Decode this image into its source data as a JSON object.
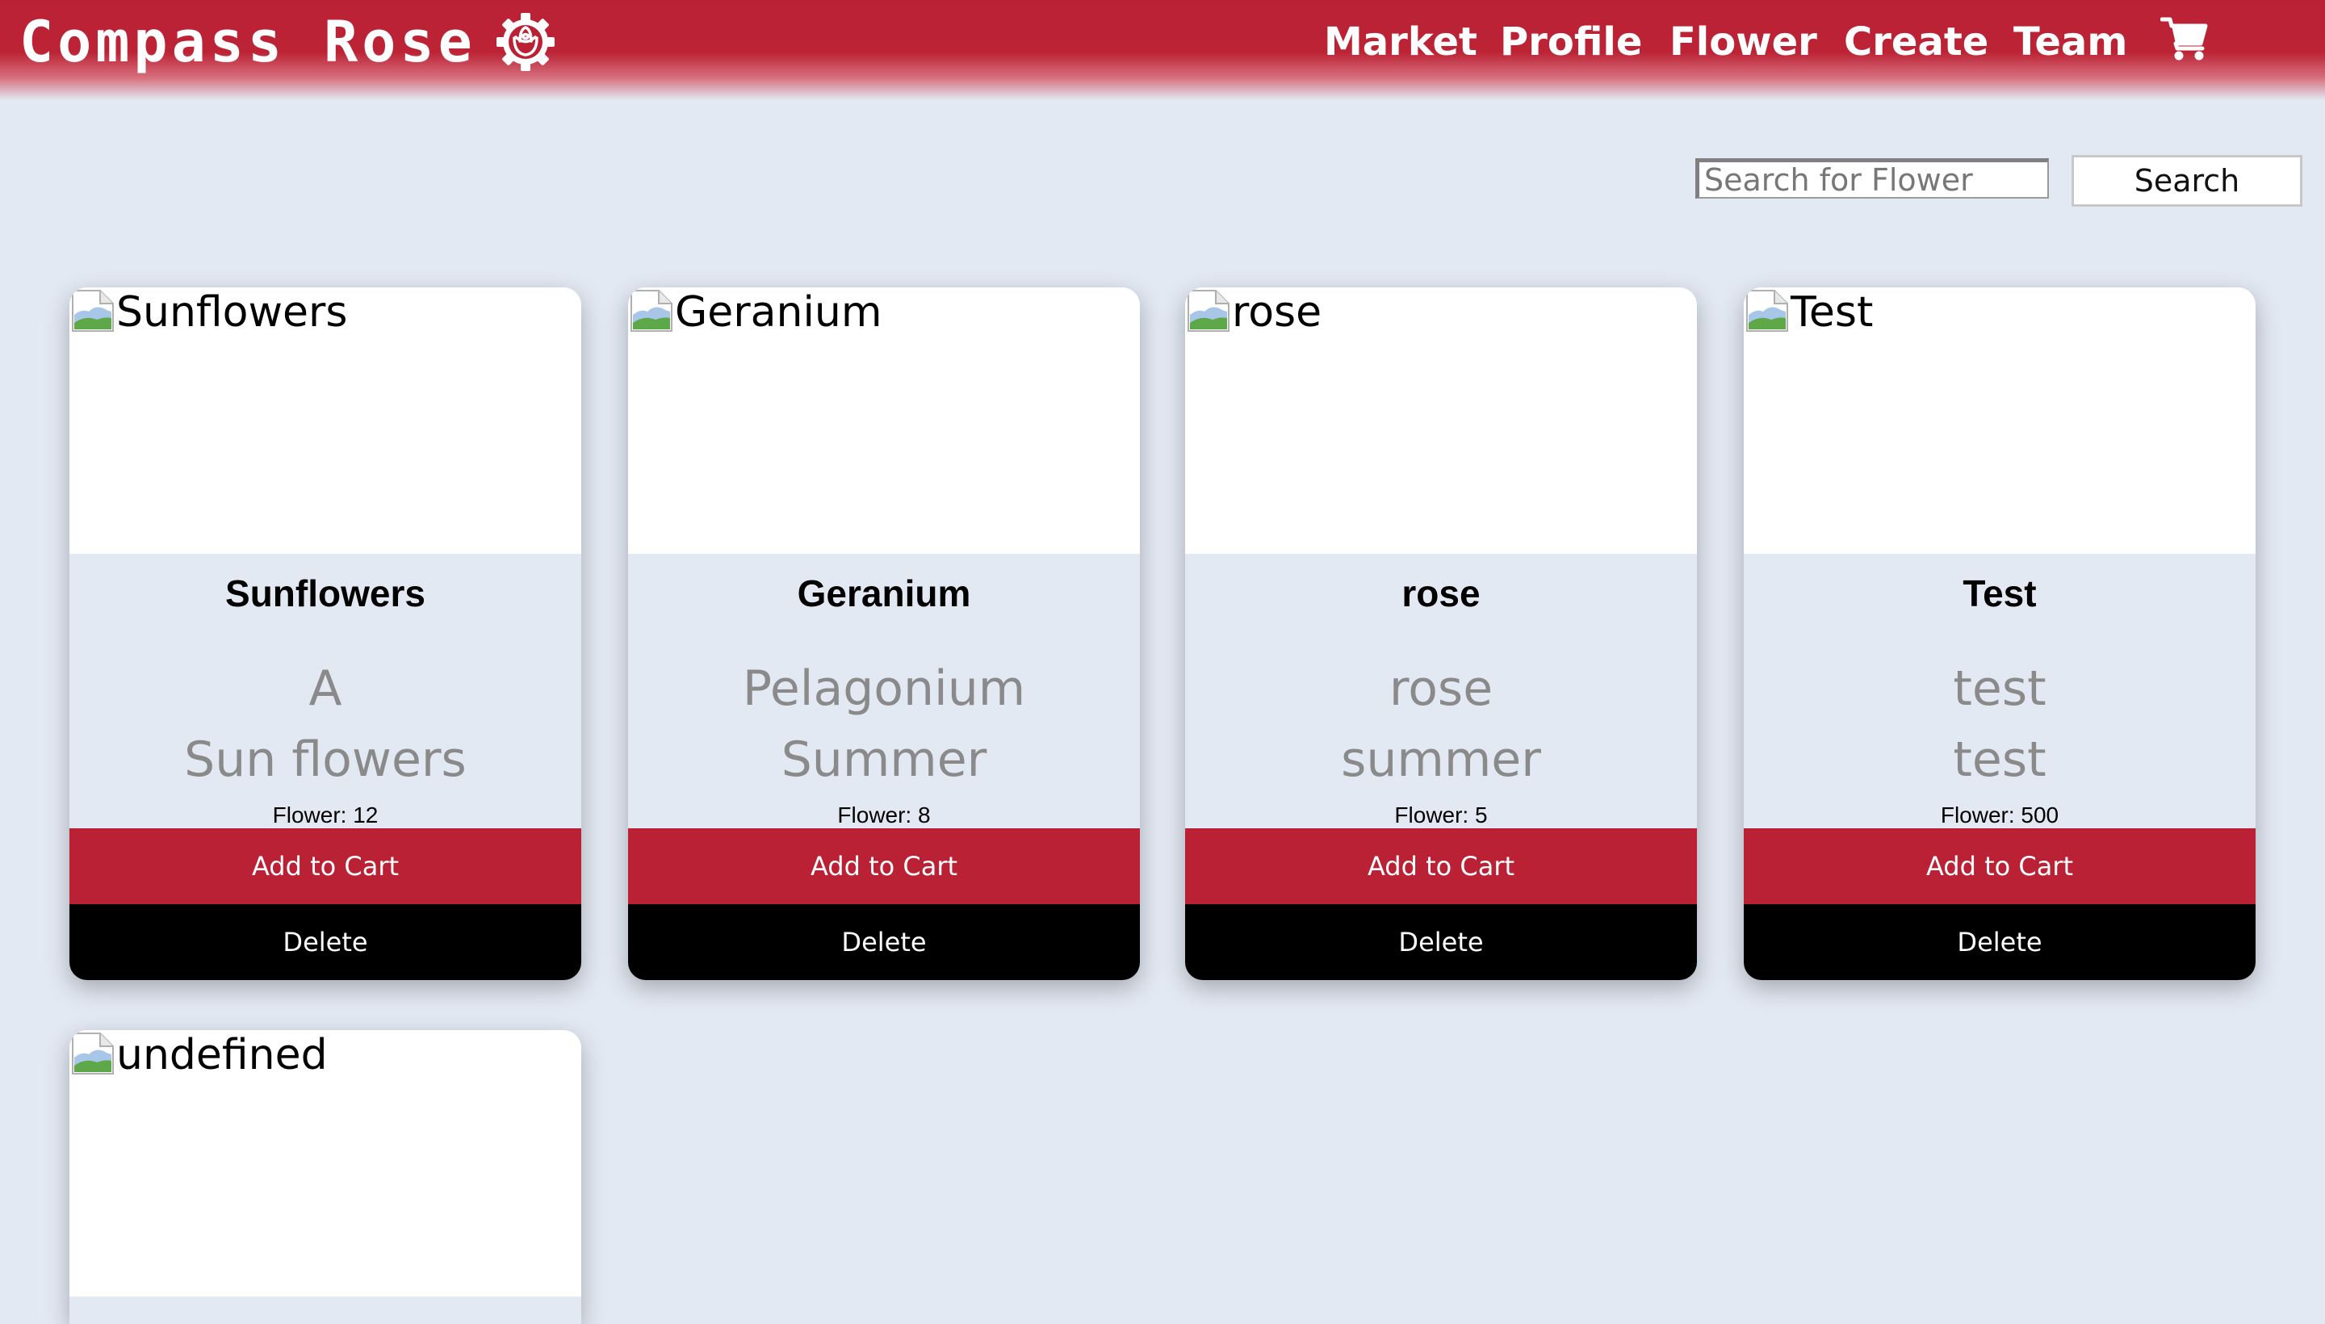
{
  "header": {
    "brand": "Compass Rose",
    "logo_icon": "rose-gear-logo-icon",
    "nav": [
      {
        "label": "Market"
      },
      {
        "label": "Profile"
      },
      {
        "label": "Flower"
      },
      {
        "label": "Create"
      },
      {
        "label": "Team"
      }
    ],
    "cart_icon": "shopping-cart-icon"
  },
  "search": {
    "placeholder": "Search for Flower",
    "value": "",
    "button_label": "Search"
  },
  "cards": [
    {
      "image_alt": "Sunflowers",
      "title": "Sunflowers",
      "desc1": "A",
      "desc2": "Sun flowers",
      "count": "Flower: 12",
      "add_label": "Add to Cart",
      "delete_label": "Delete"
    },
    {
      "image_alt": "Geranium",
      "title": "Geranium",
      "desc1": "Pelagonium",
      "desc2": "Summer",
      "count": "Flower: 8",
      "add_label": "Add to Cart",
      "delete_label": "Delete"
    },
    {
      "image_alt": "rose",
      "title": "rose",
      "desc1": "rose",
      "desc2": "summer",
      "count": "Flower: 5",
      "add_label": "Add to Cart",
      "delete_label": "Delete"
    },
    {
      "image_alt": "Test",
      "title": "Test",
      "desc1": "test",
      "desc2": "test",
      "count": "Flower: 500",
      "add_label": "Add to Cart",
      "delete_label": "Delete"
    },
    {
      "image_alt": "undefined"
    }
  ],
  "colors": {
    "brand_red": "#bb2135",
    "page_background": "#e3e9f3",
    "delete_black": "#000000"
  }
}
